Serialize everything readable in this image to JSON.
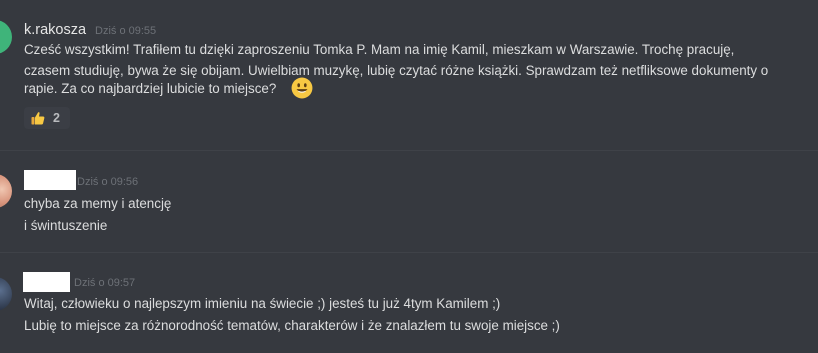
{
  "messages": [
    {
      "author": "k.rakosza",
      "timestamp": "Dziś o 09:55",
      "lines": [
        "Cześć wszystkim! Trafiłem tu dzięki zaproszeniu Tomka P. Mam na imię Kamil, mieszkam w Warszawie. Trochę pracuję,",
        "czasem studiuję, bywa że się obijam. Uwielbiam muzykę, lubię czytać różne książki. Sprawdzam też netfliksowe dokumenty o",
        "rapie. Za co najbardziej lubicie to miejsce?"
      ],
      "emoji": "smiley-emoji",
      "reaction": {
        "icon": "thumbs-up-emoji",
        "count": "2"
      }
    },
    {
      "author": "",
      "timestamp": "Dziś o 09:56",
      "lines": [
        "chyba za memy i atencję",
        "i świntuszenie"
      ]
    },
    {
      "author": "",
      "timestamp": "Dziś o 09:57",
      "lines": [
        "Witaj, człowieku o najlepszym imieniu na świecie ;) jesteś tu już 4tym Kamilem ;)",
        "Lubię to miejsce za różnorodność tematów, charakterów i że znalazłem tu swoje miejsce ;)"
      ]
    }
  ],
  "colors": {
    "background": "#36393f",
    "text": "#dcddde",
    "timestamp": "#6d7177",
    "avatar_green": "#3fb47a"
  }
}
